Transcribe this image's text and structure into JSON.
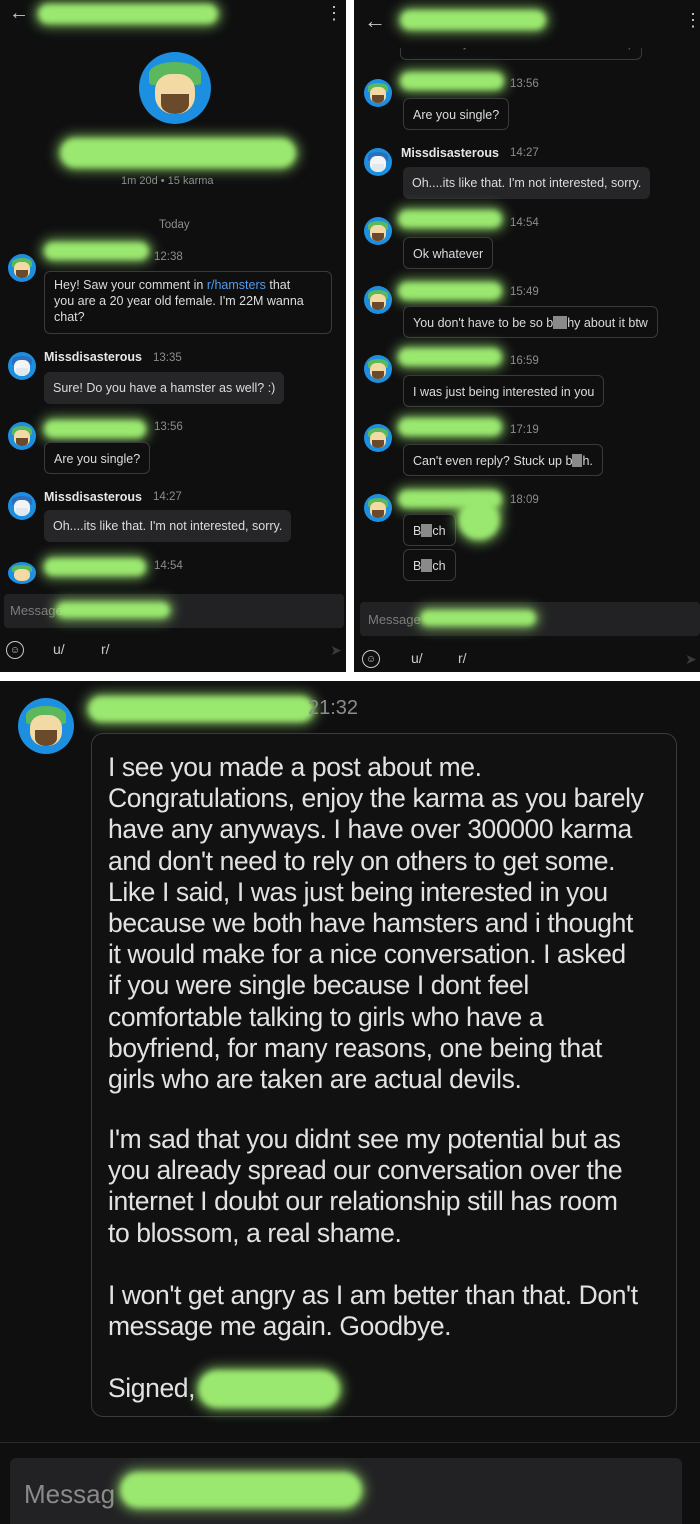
{
  "left_screen": {
    "profile_meta": "1m 20d • 15 karma",
    "date_divider": "Today",
    "messages": [
      {
        "time": "12:38",
        "text_parts": [
          "Hey! Saw your comment in ",
          "r/hamsters",
          " that"
        ],
        "line2": "you are a 20 year old female. I'm 22M wanna",
        "line3": "chat?"
      },
      {
        "sender": "Missdisasterous",
        "time": "13:35",
        "text": "Sure! Do you have a hamster as well? :)"
      },
      {
        "time": "13:56",
        "text": "Are you single?"
      },
      {
        "sender": "Missdisasterous",
        "time": "14:27",
        "text": "Oh....its like that. I'm not interested, sorry."
      },
      {
        "time": "14:54"
      }
    ],
    "composer_placeholder": "Message",
    "bar": {
      "user_prefix": "u/",
      "sub_prefix": "r/"
    }
  },
  "right_screen": {
    "top_cutoff_text": "Sure! Do you have a hamster as well? :)",
    "messages": [
      {
        "time": "13:56",
        "text": "Are you single?"
      },
      {
        "sender": "Missdisasterous",
        "time": "14:27",
        "text": "Oh....its like that. I'm not interested, sorry."
      },
      {
        "time": "14:54",
        "text": "Ok whatever"
      },
      {
        "time": "15:49",
        "text_a": "You don't have to be so b",
        "text_b": "hy about it btw"
      },
      {
        "time": "16:59",
        "text": "I was just being interested in you"
      },
      {
        "time": "17:19",
        "text_a": "Can't even reply? Stuck up b",
        "text_b": "h."
      },
      {
        "time": "18:09",
        "text_a": "B",
        "text_b": "ch"
      },
      {
        "text_a": "B",
        "text_b": "ch"
      }
    ],
    "composer_placeholder": "Message",
    "bar": {
      "user_prefix": "u/",
      "sub_prefix": "r/"
    }
  },
  "bottom_screen": {
    "time": "21:32",
    "paragraph1": [
      "I see you made a post about me.",
      "Congratulations, enjoy the karma as you barely",
      "have any anyways. I have over 300000 karma",
      "and don't need to rely on others to get some.",
      "Like I said, I was just being interested in you",
      "because we both have hamsters and i thought",
      "it would make for a nice conversation. I asked",
      "if you were single because I dont feel",
      "comfortable talking to girls who have a",
      "boyfriend, for many reasons, one being that",
      "girls who are taken are actual devils."
    ],
    "paragraph2": [
      "I'm sad that you didnt see my potential but as",
      "you already spread our conversation over the",
      "internet I doubt our relationship still has room",
      "to blossom, a real shame."
    ],
    "paragraph3": [
      "I won't get angry as I am better than that. Don't",
      "message me again. Goodbye."
    ],
    "signoff": "Signed,",
    "composer_placeholder": "Messag"
  }
}
